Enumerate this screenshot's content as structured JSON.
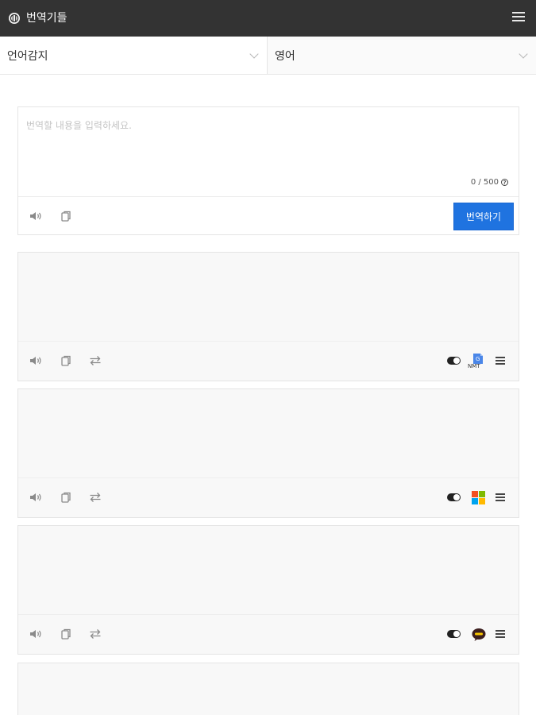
{
  "app": {
    "title": "번역기들"
  },
  "languages": {
    "source": "언어감지",
    "target": "영어"
  },
  "input": {
    "placeholder": "번역할 내용을 입력하세요.",
    "counter": "0 / 500",
    "help": "?"
  },
  "buttons": {
    "translate": "번역하기"
  },
  "engines": [
    {
      "icon": "papago-nmt-icon",
      "label": "NMT"
    },
    {
      "icon": "microsoft-icon"
    },
    {
      "icon": "kakao-icon"
    }
  ],
  "colors": {
    "topbar": "#333333",
    "accent": "#1f73e0",
    "card_bg": "#f8f8f8"
  }
}
